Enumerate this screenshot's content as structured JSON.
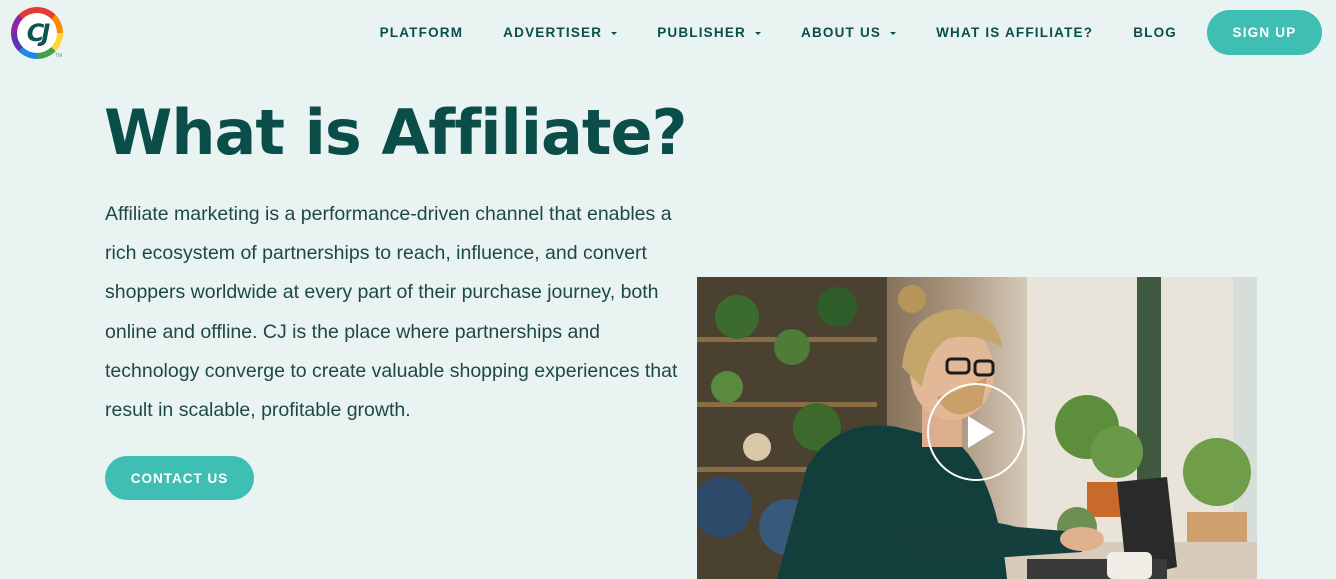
{
  "nav": {
    "items": [
      {
        "label": "PLATFORM",
        "dropdown": false
      },
      {
        "label": "ADVERTISER",
        "dropdown": true
      },
      {
        "label": "PUBLISHER",
        "dropdown": true
      },
      {
        "label": "ABOUT US",
        "dropdown": true
      },
      {
        "label": "WHAT IS AFFILIATE?",
        "dropdown": false
      },
      {
        "label": "BLOG",
        "dropdown": false
      }
    ],
    "signup_label": "SIGN UP"
  },
  "logo": {
    "text": "CJ",
    "tm": "TM"
  },
  "hero": {
    "title": "What is Affiliate?",
    "description": "Affiliate marketing is a performance-driven channel that enables a rich ecosystem of partnerships to reach, influence, and convert shoppers worldwide at every part of their purchase journey, both online and offline. CJ is the place where partnerships and technology converge to create valuable shopping experiences that result in scalable, profitable growth.",
    "cta_label": "CONTACT US"
  },
  "video": {
    "icon": "play-icon"
  },
  "colors": {
    "background": "#e9f4f2",
    "heading": "#0b4d49",
    "accent": "#3fbfb4",
    "button_text": "#ffffff"
  }
}
